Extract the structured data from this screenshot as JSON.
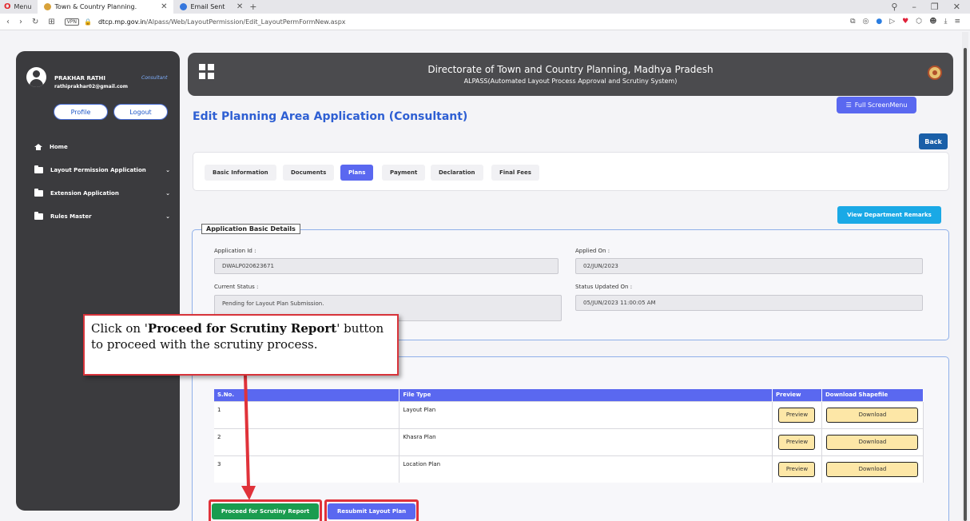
{
  "browser": {
    "menu_label": "Menu",
    "tabs": [
      {
        "label": "Town & Country Planning.",
        "active": true
      },
      {
        "label": "Email Sent",
        "active": false
      }
    ],
    "url_host": "dtcp.mp.gov.in",
    "url_path": "/Alpass/Web/LayoutPermission/Edit_LayoutPermFormNew.aspx",
    "vpn_label": "VPN"
  },
  "sidebar": {
    "user_name": "PRAKHAR RATHI",
    "user_role": "Consultant",
    "user_email": "rathiprakhar02@gmail.com",
    "profile_label": "Profile",
    "logout_label": "Logout",
    "items": [
      {
        "label": "Home",
        "icon": "home-icon",
        "has_chevron": false
      },
      {
        "label": "Layout Permission Application",
        "icon": "folder-icon",
        "has_chevron": true
      },
      {
        "label": "Extension Application",
        "icon": "folder-icon",
        "has_chevron": true
      },
      {
        "label": "Rules Master",
        "icon": "folder-icon",
        "has_chevron": true
      }
    ]
  },
  "header": {
    "title": "Directorate of Town and Country Planning, Madhya Pradesh",
    "subtitle": "ALPASS(Automated Layout Process Approval and Scrutiny System)"
  },
  "page": {
    "fullscreen_label": "Full ScreenMenu",
    "title": "Edit Planning Area Application (Consultant)",
    "back_label": "Back",
    "remarks_label": "View Department Remarks"
  },
  "tabs": [
    {
      "label": "Basic Information",
      "active": false
    },
    {
      "label": "Documents",
      "active": false
    },
    {
      "label": "Plans",
      "active": true
    },
    {
      "label": "Payment",
      "active": false
    },
    {
      "label": "Declaration",
      "active": false
    },
    {
      "label": "Final Fees",
      "active": false
    }
  ],
  "basic_details": {
    "legend": "Application Basic Details",
    "application_id_label": "Application Id :",
    "application_id_value": "DWALP020623671",
    "applied_on_label": "Applied On :",
    "applied_on_value": "02/JUN/2023",
    "current_status_label": "Current Status :",
    "current_status_value": "Pending for Layout Plan Submission.",
    "status_updated_label": "Status Updated On :",
    "status_updated_value": "05/JUN/2023 11:00:05 AM"
  },
  "files_table": {
    "headers": [
      "S.No.",
      "File Type",
      "Preview",
      "Download Shapefile"
    ],
    "rows": [
      {
        "sno": "1",
        "file_type": "Layout Plan"
      },
      {
        "sno": "2",
        "file_type": "Khasra Plan"
      },
      {
        "sno": "3",
        "file_type": "Location Plan"
      }
    ],
    "preview_label": "Preview",
    "download_label": "Download"
  },
  "actions": {
    "proceed_label": "Proceed for Scrutiny Report",
    "resubmit_label": "Resubmit Layout Plan"
  },
  "callout": {
    "text_before": "Click on '",
    "text_bold": "Proceed for Scrutiny Report",
    "text_after": "' button to proceed with the scrutiny process."
  },
  "colors": {
    "accent": "#5a68f0",
    "highlight": "#e0323a",
    "proceed": "#1a9c4f",
    "sidebar": "#3b3b3e"
  }
}
